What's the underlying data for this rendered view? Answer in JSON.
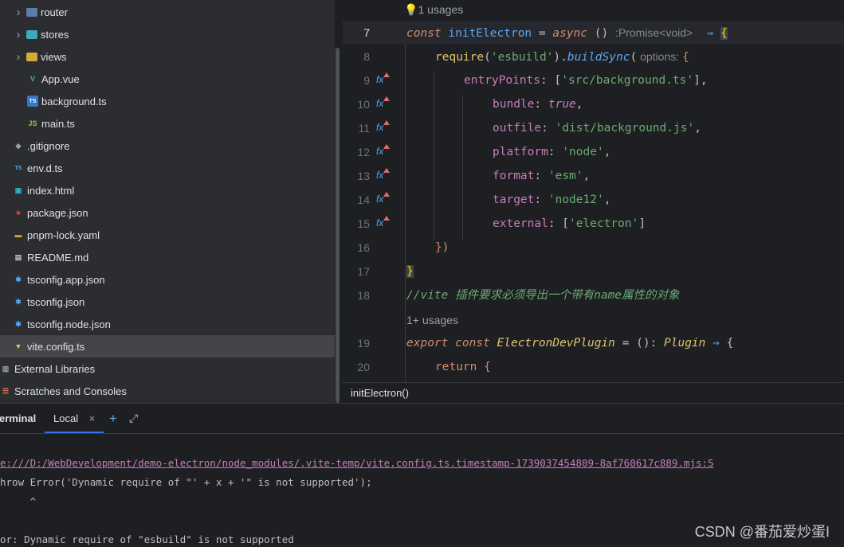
{
  "project_tree": [
    {
      "name": "router",
      "kind": "folder",
      "indent": 1,
      "color": "#5b7fa6"
    },
    {
      "name": "stores",
      "kind": "folder",
      "indent": 1,
      "color": "#3fa9b5"
    },
    {
      "name": "views",
      "kind": "folder",
      "indent": 1,
      "color": "#d6a93b"
    },
    {
      "name": "App.vue",
      "kind": "vue",
      "indent": 2
    },
    {
      "name": "background.ts",
      "kind": "ts",
      "indent": 2
    },
    {
      "name": "main.ts",
      "kind": "js",
      "indent": 2
    },
    {
      "name": ".gitignore",
      "kind": "git",
      "indent": 0
    },
    {
      "name": "env.d.ts",
      "kind": "dts",
      "indent": 0
    },
    {
      "name": "index.html",
      "kind": "html",
      "indent": 0
    },
    {
      "name": "package.json",
      "kind": "npm",
      "indent": 0
    },
    {
      "name": "pnpm-lock.yaml",
      "kind": "yaml",
      "indent": 0
    },
    {
      "name": "README.md",
      "kind": "md",
      "indent": 0
    },
    {
      "name": "tsconfig.app.json",
      "kind": "cfg",
      "indent": 0
    },
    {
      "name": "tsconfig.json",
      "kind": "cfg",
      "indent": 0
    },
    {
      "name": "tsconfig.node.json",
      "kind": "cfg",
      "indent": 0
    },
    {
      "name": "vite.config.ts",
      "kind": "vite",
      "indent": 0,
      "selected": true
    },
    {
      "name": "External Libraries",
      "kind": "lib",
      "indent": -1
    },
    {
      "name": "Scratches and Consoles",
      "kind": "scratch",
      "indent": -1
    }
  ],
  "editor": {
    "usages_top": "1 usages",
    "usages_mid": "1+ usages",
    "lines": {
      "l7": "7",
      "l8": "8",
      "l9": "9",
      "l10": "10",
      "l11": "11",
      "l12": "12",
      "l13": "13",
      "l14": "14",
      "l15": "15",
      "l16": "16",
      "l17": "17",
      "l18": "18",
      "l19": "19",
      "l20": "20"
    },
    "code": {
      "l7_const": "const ",
      "l7_name": "initElectron",
      "l7_eq": " = ",
      "l7_async": "async",
      "l7_parens": " () ",
      "l7_hint": ":Promise<void>",
      "l7_arrow": "  ⇒ ",
      "l7_brace": "{",
      "l8_require": "require",
      "l8_paren": "(",
      "l8_str": "'esbuild'",
      "l8_close": ").",
      "l8_fn": "buildSync",
      "l8_open": "(",
      "l8_hint": " options: ",
      "l8_brace": "{",
      "l9_key": "entryPoints",
      "l9_colon": ": [",
      "l9_str": "'src/background.ts'",
      "l9_end": "],",
      "l10_key": "bundle",
      "l10_colon": ": ",
      "l10_val": "true",
      "l10_end": ",",
      "l11_key": "outfile",
      "l11_colon": ": ",
      "l11_val": "'dist/background.js'",
      "l11_end": ",",
      "l12_key": "platform",
      "l12_colon": ": ",
      "l12_val": "'node'",
      "l12_end": ",",
      "l13_key": "format",
      "l13_colon": ": ",
      "l13_val": "'esm'",
      "l13_end": ",",
      "l14_key": "target",
      "l14_colon": ": ",
      "l14_val": "'node12'",
      "l14_end": ",",
      "l15_key": "external",
      "l15_colon": ": [",
      "l15_val": "'electron'",
      "l15_end": "]",
      "l16": "})",
      "l17": "}",
      "l18": "//vite 插件要求必须导出一个带有name属性的对象",
      "l19_export": "export ",
      "l19_const": "const ",
      "l19_name": "ElectronDevPlugin",
      "l19_eq": " = (): ",
      "l19_type": "Plugin",
      "l19_arrow": " ⇒ ",
      "l19_brace": "{",
      "l20_return": "return ",
      "l20_brace": "{"
    },
    "breadcrumb": "initElectron()"
  },
  "terminal": {
    "title": "erminal",
    "tab": "Local",
    "close": "×",
    "add": "+",
    "expand": "⤢",
    "lines": {
      "link": "e:///D:/WebDevelopment/demo-electron/node_modules/.vite-temp/vite.config.ts.timestamp-1739037454809-8af760617c889.mjs:5",
      "throw": "hrow Error('Dynamic require of \"' + x + '\" is not supported');",
      "caret": "     ^",
      "error": "or: Dynamic require of \"esbuild\" is not supported"
    }
  },
  "watermark": "CSDN @番茄爱炒蛋I"
}
